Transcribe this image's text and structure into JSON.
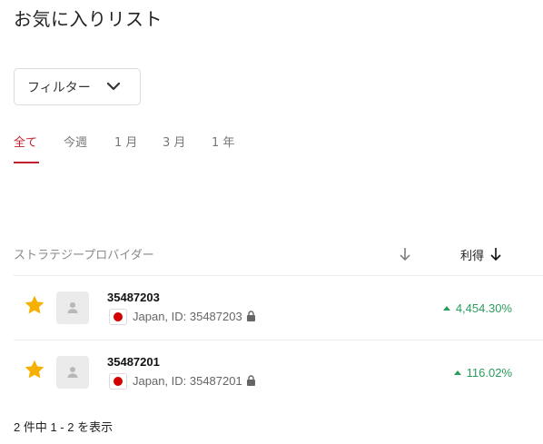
{
  "page": {
    "title": "お気に入りリスト"
  },
  "filter": {
    "label": "フィルター",
    "icon": "chevron-down-icon"
  },
  "tabs": [
    {
      "label": "全て",
      "active": true
    },
    {
      "label": "今週",
      "active": false
    },
    {
      "label": "1 月",
      "active": false
    },
    {
      "label": "3 月",
      "active": false
    },
    {
      "label": "1 年",
      "active": false
    }
  ],
  "colors": {
    "accent": "#c0202d",
    "positive": "#2a9d5c",
    "star": "#f5b000"
  },
  "table": {
    "header": {
      "provider": "ストラテジープロバイダー",
      "profit": "利得"
    },
    "rows": [
      {
        "name": "35487203",
        "meta": "Japan, ID: 35487203",
        "country_flag": "japan-flag-icon",
        "profit": "4,454.30%",
        "favorited": true
      },
      {
        "name": "35487201",
        "meta": "Japan, ID: 35487201",
        "country_flag": "japan-flag-icon",
        "profit": "116.02%",
        "favorited": true
      }
    ]
  },
  "pagination": {
    "summary": "2 件中 1 - 2 を表示"
  }
}
